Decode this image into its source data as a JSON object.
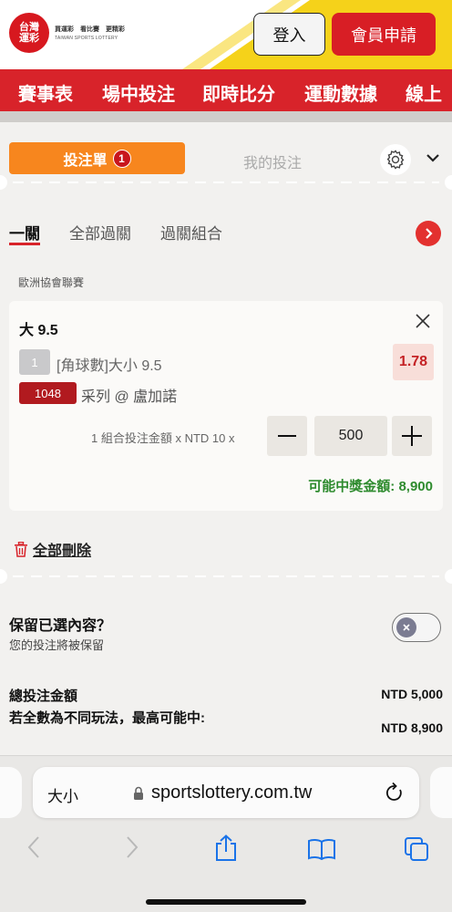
{
  "colors": {
    "brand_red": "#d8232a",
    "orange": "#f7861e",
    "green_payout": "#2e8b2e",
    "yellow_stripe": "#f5d21a"
  },
  "header": {
    "logo_main": [
      "台灣",
      "運彩"
    ],
    "logo_tagline": "買運彩　看比賽　更精彩",
    "logo_english": "TAIWAN SPORTS LOTTERY",
    "login_label": "登入",
    "register_label": "會員申請"
  },
  "nav": {
    "items": [
      "賽事表",
      "場中投注",
      "即時比分",
      "運動數據",
      "線上"
    ]
  },
  "slip": {
    "tab_betslip": "投注單",
    "tab_betslip_count": "1",
    "tab_my_bets": "我的投注",
    "subtabs": [
      "一關",
      "全部過關",
      "過關組合"
    ],
    "active_subtab": "一關"
  },
  "bet": {
    "league": "歐洲協會聯賽",
    "title": "大 9.5",
    "line_number": "1",
    "market": "[角球數]大小 9.5",
    "odds": "1.78",
    "game_code": "1048",
    "selection": "采列 @ 盧加諾",
    "stake_label": "1 組合投注金額 x NTD 10 x",
    "stake_value": "500",
    "payout_label": "可能中獎金額: 8,900"
  },
  "actions": {
    "delete_all_label": "全部刪除"
  },
  "keep": {
    "title": "保留已選內容？",
    "subtitle": "您的投注將被保留",
    "enabled": false
  },
  "totals": {
    "total_label": "總投注金額",
    "total_value": "NTD 5,000",
    "max_label": "若全數為不同玩法，最高可能中:",
    "max_value": "NTD 8,900"
  },
  "browser": {
    "text_size_label": "大小",
    "url": "sportslottery.com.tw"
  }
}
